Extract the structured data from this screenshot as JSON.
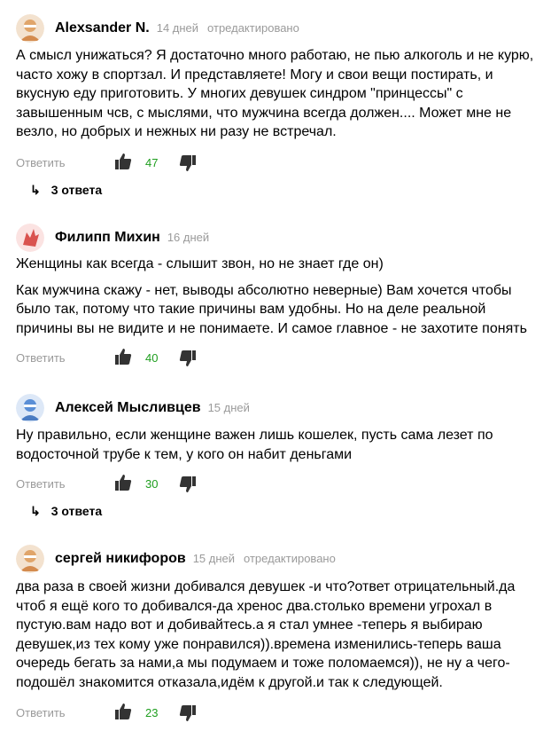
{
  "comments": [
    {
      "author": "Alexsander N.",
      "time": "14 дней",
      "edited": "отредактировано",
      "paragraphs": [
        "А смысл унижаться? Я достаточно много работаю, не пью алкоголь и не курю, часто хожу в спортзал. И представляете! Могу и свои вещи постирать, и вкусную еду приготовить. У многих девушек синдром \"принцессы\" с завышенным чсв, с мыслями, что мужчина всегда должен.... Может мне не везло, но добрых и нежных ни разу не встречал."
      ],
      "reply": "Ответить",
      "likes": "47",
      "answers": "3 ответа",
      "avatar_color": "#e0a56a"
    },
    {
      "author": "Филипп Михин",
      "time": "16 дней",
      "edited": "",
      "paragraphs": [
        "Женщины как всегда - слышит звон, но не знает где он)",
        "Как мужчина скажу - нет, выводы абсолютно неверные) Вам хочется чтобы было так, потому что такие причины вам удобны. Но на деле реальной причины вы не видите и не понимаете. И самое главное - не захотите понять"
      ],
      "reply": "Ответить",
      "likes": "40",
      "answers": "",
      "avatar_color": "#d9534f"
    },
    {
      "author": "Алексей Мысливцев",
      "time": "15 дней",
      "edited": "",
      "paragraphs": [
        "Ну правильно, если женщине важен лишь кошелек, пусть сама лезет по водосточной трубе к тем, у кого он набит деньгами"
      ],
      "reply": "Ответить",
      "likes": "30",
      "answers": "3 ответа",
      "avatar_color": "#5b8fd6"
    },
    {
      "author": "сергей никифоров",
      "time": "15 дней",
      "edited": "отредактировано",
      "paragraphs": [
        "два раза в своей жизни добивался девушек -и что?ответ отрицательный.да чтоб я ещё кого то добивался-да хренос два.столько времени угрохал в пустую.вам надо вот и добивайтесь.а я стал умнее -теперь я выбираю девушек,из тех кому уже понравился)).времена изменились-теперь ваша очередь бегать за нами,а мы подумаем и тоже поломаемся)), не ну а чего- подошёл знакомится отказала,идём к другой.и так к следующей."
      ],
      "reply": "Ответить",
      "likes": "23",
      "answers": "",
      "avatar_color": "#e0a56a"
    }
  ],
  "icons": {
    "like": "thumbs-up-icon",
    "dislike": "thumbs-down-icon",
    "answers": "reply-arrow-icon"
  },
  "colors": {
    "likes": "#1e9e1e",
    "muted": "#9a9a9a"
  }
}
